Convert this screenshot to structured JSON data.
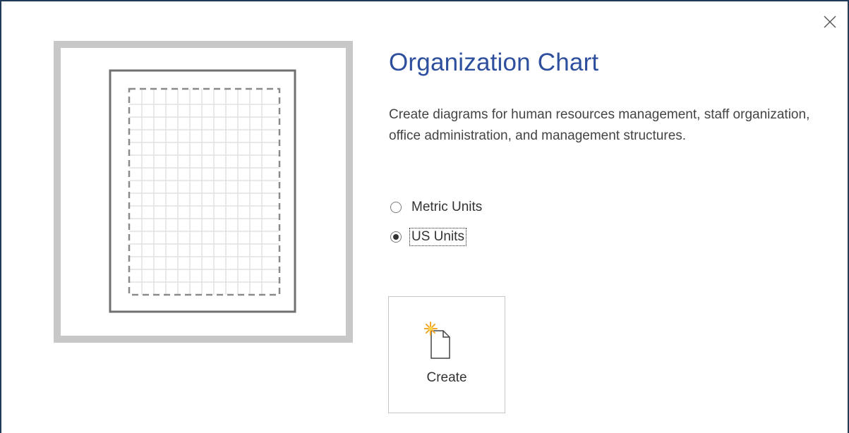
{
  "dialog": {
    "title": "Organization Chart",
    "description": "Create diagrams for human resources management, staff organization, office administration, and management structures.",
    "close_icon": "close-icon",
    "accent_color": "#2e4f9d"
  },
  "units": {
    "options": [
      {
        "label": "Metric Units",
        "selected": false
      },
      {
        "label": "US Units",
        "selected": true
      }
    ]
  },
  "create_button": {
    "label": "Create",
    "icon": "new-document-icon"
  },
  "preview": {
    "icon": "template-preview-thumbnail"
  }
}
